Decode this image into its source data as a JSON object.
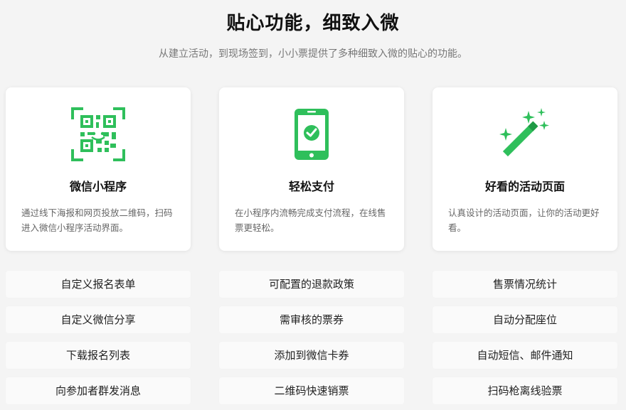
{
  "header": {
    "title": "贴心功能，细致入微",
    "subtitle": "从建立活动，到现场签到，小小票提供了多种细致入微的贴心的功能。"
  },
  "colors": {
    "accent": "#2fbf5b"
  },
  "cards": [
    {
      "icon": "qr-code-icon",
      "title": "微信小程序",
      "desc": "通过线下海报和网页投放二维码，扫码进入微信小程序活动界面。"
    },
    {
      "icon": "phone-pay-icon",
      "title": "轻松支付",
      "desc": "在小程序内流畅完成支付流程，在线售票更轻松。"
    },
    {
      "icon": "magic-wand-icon",
      "title": "好看的活动页面",
      "desc": "认真设计的活动页面，让你的活动更好看。"
    }
  ],
  "features": [
    [
      "自定义报名表单",
      "可配置的退款政策",
      "售票情况统计"
    ],
    [
      "自定义微信分享",
      "需审核的票券",
      "自动分配座位"
    ],
    [
      "下载报名列表",
      "添加到微信卡券",
      "自动短信、邮件通知"
    ],
    [
      "向参加者群发消息",
      "二维码快速销票",
      "扫码枪离线验票"
    ]
  ]
}
